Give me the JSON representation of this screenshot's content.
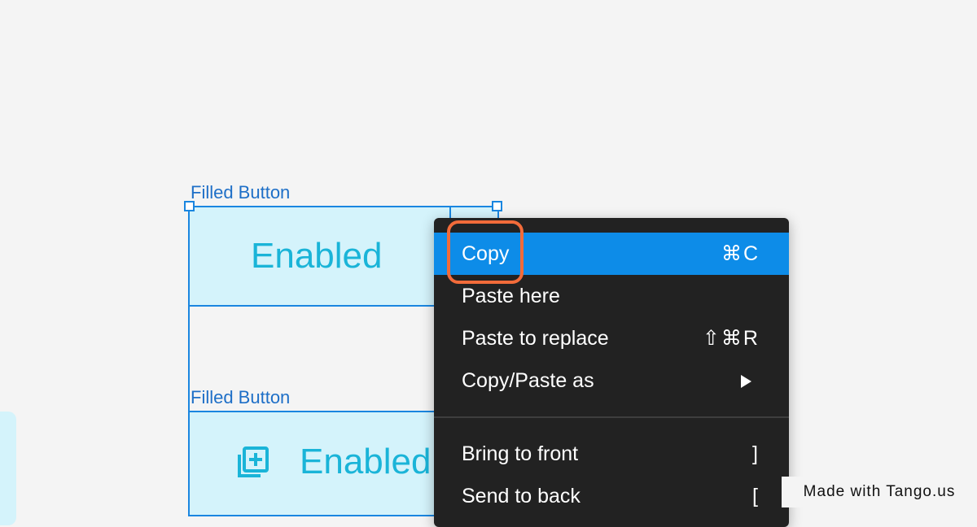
{
  "canvas": {
    "frames": [
      {
        "label": "Filled Button",
        "button_text": "Enabled"
      },
      {
        "label": "Filled Button",
        "button_text": "Enabled",
        "icon": "library-add-icon"
      }
    ]
  },
  "context_menu": {
    "items": [
      {
        "label": "Copy",
        "shortcut": "⌘C",
        "active": true
      },
      {
        "label": "Paste here",
        "shortcut": ""
      },
      {
        "label": "Paste to replace",
        "shortcut": "⇧⌘R"
      },
      {
        "label": "Copy/Paste as",
        "submenu": true
      },
      {
        "label": "Bring to front",
        "shortcut": "]"
      },
      {
        "label": "Send to back",
        "shortcut": "["
      }
    ]
  },
  "colors": {
    "canvas_bg": "#f4f4f4",
    "selection": "#1a86e0",
    "button_fill": "#d4f3fb",
    "button_text": "#1ab4d8",
    "menu_bg": "#222222",
    "menu_active": "#0d8ce8",
    "highlight": "#f26b3a"
  },
  "watermark": {
    "text": "Made with Tango.us"
  }
}
